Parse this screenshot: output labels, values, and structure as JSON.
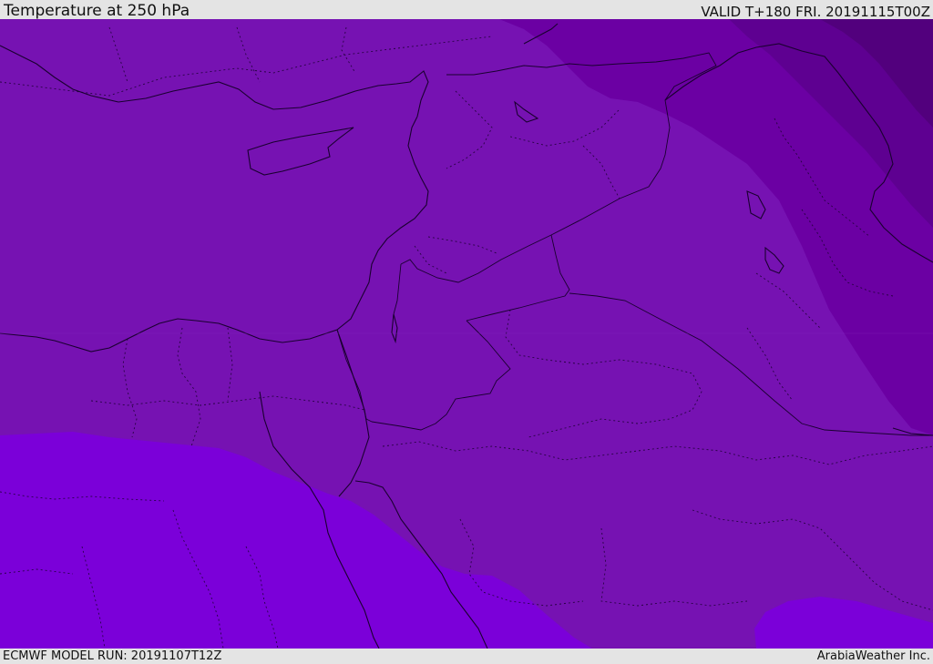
{
  "header": {
    "title": "Temperature at 250 hPa",
    "valid": "VALID T+180 FRI. 20191115T00Z"
  },
  "footer": {
    "model_run": "ECMWF MODEL RUN: 20191107T12Z",
    "credit": "ArabiaWeather Inc."
  },
  "map": {
    "field": "temperature-250hPa",
    "colors": {
      "band_warm": "#7b00d9",
      "band_mid": "#7612b2",
      "band_cool": "#6b00a3",
      "band_colder": "#5e0091",
      "band_coldest": "#52007d",
      "coastline": "#1a0030",
      "border": "#1a0030"
    }
  }
}
